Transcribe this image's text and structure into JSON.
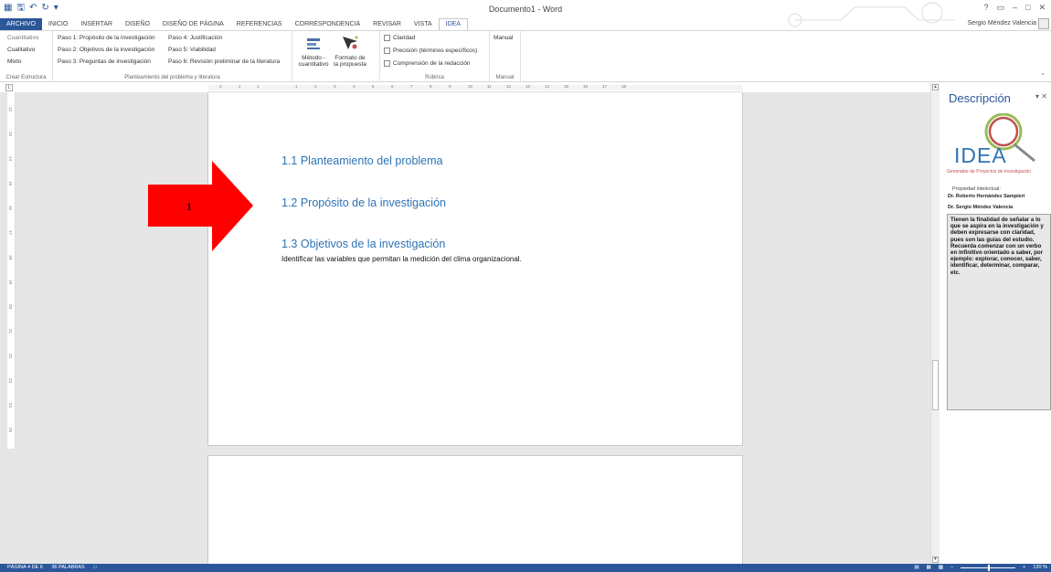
{
  "window": {
    "title": "Documento1 - Word",
    "user": "Sergio Méndez Valencia",
    "help": "?",
    "controls": [
      "▭",
      "–",
      "□",
      "✕"
    ]
  },
  "tabs": [
    "ARCHIVO",
    "INICIO",
    "INSERTAR",
    "DISEÑO",
    "DISEÑO DE PÁGINA",
    "REFERENCIAS",
    "CORRESPONDENCIA",
    "REVISAR",
    "VISTA",
    "IDEA"
  ],
  "ribbon": {
    "crear": {
      "items": [
        "Cuantitativo",
        "Cualitativo",
        "Mixto"
      ],
      "label": "Crear Estructura"
    },
    "planteamiento": {
      "col1": [
        "Paso 1: Propósito de la investigación",
        "Paso 2: Objetivos de la investigación",
        "Paso 3: Preguntas de investigación"
      ],
      "col2": [
        "Paso 4: Justificación",
        "Paso 5: Viabilidad",
        "Paso 6: Revisión preliminar de la literatura"
      ],
      "label": "Planteamiento del problema y literatura"
    },
    "metodo": {
      "big1": "Método - cuantitativo",
      "big2": "Formato de la propuesta"
    },
    "rubrica": {
      "items": [
        "Claridad",
        "Precisión (términos específicos)",
        "Comprensión de la redacción"
      ],
      "label": "Rúbrica"
    },
    "manual": {
      "item": "Manual",
      "label": "Manual"
    }
  },
  "ruler_ticks": [
    "3",
    "2",
    "1",
    "1",
    "2",
    "3",
    "4",
    "5",
    "6",
    "7",
    "8",
    "9",
    "10",
    "11",
    "12",
    "13",
    "14",
    "15",
    "16",
    "17",
    "18"
  ],
  "vruler_ticks": [
    "12",
    "13",
    "14",
    "15",
    "16",
    "17",
    "18",
    "19",
    "20",
    "21",
    "22",
    "23",
    "24",
    "25"
  ],
  "document": {
    "h1": "1.1 Planteamiento del problema",
    "h2": "1.2 Propósito de la investigación",
    "h3": "1.3 Objetivos de la investigación",
    "body": "Identificar las variables que permitan la medición del clima organizacional."
  },
  "annotation": {
    "number": "1",
    "color": "#ff0000"
  },
  "pane": {
    "title": "Descripción",
    "logo_text": "IDEA",
    "logo_sub": "Generador de Proyectos de Investigación",
    "prop_label": "Propiedad intelectual:",
    "author1": "Dr. Roberto Hernández Sampieri",
    "author2": "Dr. Sergio Méndez Valencia",
    "description": "Tienen la finalidad de señalar a lo que se aspira en la investigación y deben expresarse con claridad, pues son las guías del estudio. Recuerda comenzar con un verbo en infinitivo orientado a saber, por ejemplo: explorar, conocer, saber, identificar, determinar, comparar, etc."
  },
  "status": {
    "page": "PÁGINA 4 DE 6",
    "words": "36 PALABRAS",
    "zoom": "120 %"
  },
  "colors": {
    "word_blue": "#2b579a",
    "heading": "#2e74b5",
    "arrow": "#ff0000"
  }
}
